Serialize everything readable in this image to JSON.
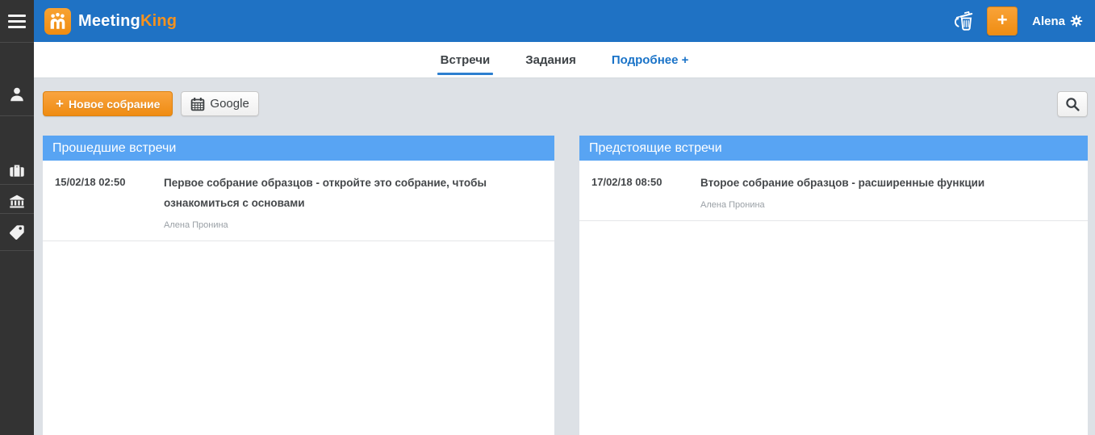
{
  "brand": {
    "name_part1": "Meeting",
    "name_part2": "King"
  },
  "header": {
    "add_button_label": "+",
    "user_name": "Alena"
  },
  "sidebar": {
    "icons": [
      "menu",
      "user",
      "briefcase",
      "bank",
      "tag"
    ]
  },
  "tabs": [
    {
      "label": "Встречи",
      "active": true
    },
    {
      "label": "Задания",
      "active": false
    },
    {
      "label": "Подробнее +",
      "active": false
    }
  ],
  "toolbar": {
    "new_meeting_plus": "+",
    "new_meeting_label": "Новое собрание",
    "google_label": "Google"
  },
  "panels": [
    {
      "title": "Прошедшие встречи",
      "meetings": [
        {
          "datetime": "15/02/18 02:50",
          "title": "Первое собрание образцов - откройте это собрание, чтобы ознакомиться с основами",
          "organizer": "Алена Пронина"
        }
      ]
    },
    {
      "title": "Предстоящие встречи",
      "meetings": [
        {
          "datetime": "17/02/18 08:50",
          "title": "Второе собрание образцов - расширенные функции",
          "organizer": "Алена Пронина"
        }
      ]
    }
  ],
  "colors": {
    "header_blue": "#1f72c4",
    "panel_header_blue": "#58a4f3",
    "accent_orange": "#f6921e",
    "link_blue": "#1a73c8",
    "sidebar_dark": "#333333",
    "content_bg": "#dde1e6",
    "text_dark": "#45484b",
    "text_muted": "#9aa0a6"
  }
}
